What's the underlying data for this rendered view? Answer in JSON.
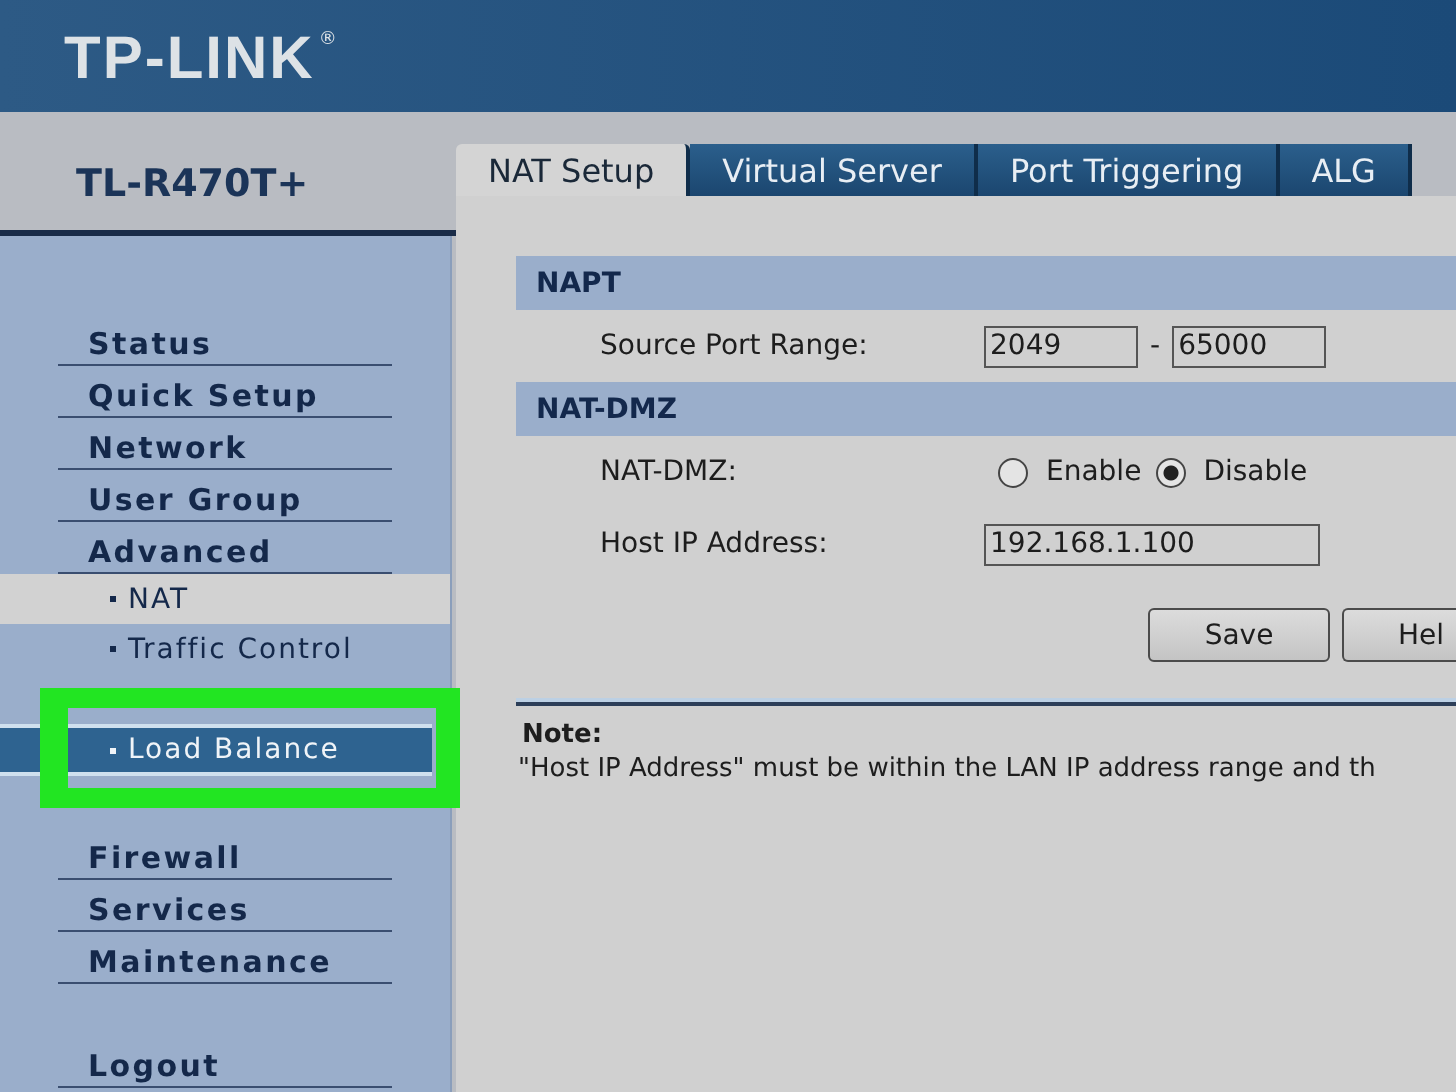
{
  "header": {
    "logo": "TP-LINK",
    "logo_mark": "®"
  },
  "model": "TL-R470T+",
  "tabs": [
    {
      "label": "NAT Setup",
      "selected": true
    },
    {
      "label": "Virtual Server",
      "selected": false
    },
    {
      "label": "Port Triggering",
      "selected": false
    },
    {
      "label": "ALG",
      "selected": false
    }
  ],
  "sidebar": {
    "items": [
      {
        "label": "Status",
        "kind": "main",
        "selected": false,
        "highlighted": false
      },
      {
        "label": "Quick Setup",
        "kind": "main",
        "selected": false,
        "highlighted": false
      },
      {
        "label": "Network",
        "kind": "main",
        "selected": false,
        "highlighted": false
      },
      {
        "label": "User Group",
        "kind": "main",
        "selected": false,
        "highlighted": false
      },
      {
        "label": "Advanced",
        "kind": "main",
        "selected": false,
        "highlighted": false
      },
      {
        "label": "NAT",
        "kind": "sub",
        "selected": true,
        "highlighted": false
      },
      {
        "label": "Traffic Control",
        "kind": "sub",
        "selected": false,
        "highlighted": false
      },
      {
        "label": "Load Balance",
        "kind": "sub",
        "selected": false,
        "highlighted": true
      },
      {
        "label": "Firewall",
        "kind": "main",
        "selected": false,
        "highlighted": false
      },
      {
        "label": "Services",
        "kind": "main",
        "selected": false,
        "highlighted": false
      },
      {
        "label": "Maintenance",
        "kind": "main",
        "selected": false,
        "highlighted": false
      },
      {
        "label": "Logout",
        "kind": "logout",
        "selected": false,
        "highlighted": false
      }
    ]
  },
  "napt": {
    "title": "NAPT",
    "label": "Source Port Range:",
    "from": "2049",
    "separator": "-",
    "to": "65000"
  },
  "nat_dmz": {
    "title": "NAT-DMZ",
    "label": "NAT-DMZ:",
    "options": [
      {
        "label": "Enable",
        "selected": false
      },
      {
        "label": "Disable",
        "selected": true
      }
    ],
    "host_label": "Host IP Address:",
    "host_value": "192.168.1.100"
  },
  "buttons": [
    "Save",
    "Hel"
  ],
  "note": {
    "title": "Note:",
    "text": "\"Host IP Address\" must be within the LAN IP address range and th"
  }
}
